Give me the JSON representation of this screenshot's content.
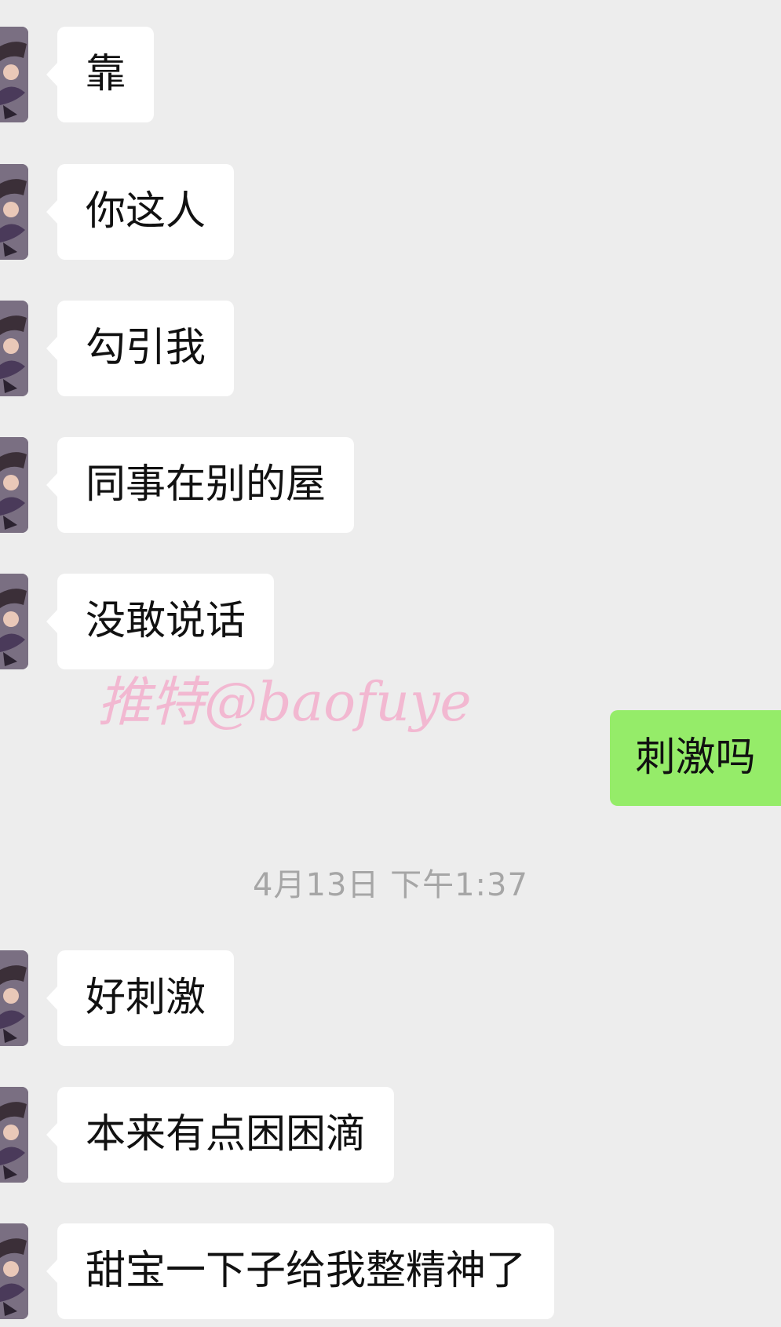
{
  "messages": [
    {
      "side": "in",
      "text": "靠"
    },
    {
      "side": "in",
      "text": "你这人"
    },
    {
      "side": "in",
      "text": "勾引我"
    },
    {
      "side": "in",
      "text": "同事在别的屋"
    },
    {
      "side": "in",
      "text": "没敢说话"
    },
    {
      "side": "out",
      "text": "刺激吗"
    },
    {
      "side": "in",
      "text": "好刺激"
    },
    {
      "side": "in",
      "text": "本来有点困困滴"
    },
    {
      "side": "in",
      "text": "甜宝一下子给我整精神了"
    }
  ],
  "timestamp": "4月13日 下午1:37",
  "watermark": "推特@baofuye",
  "colors": {
    "background": "#ededed",
    "incoming_bubble": "#ffffff",
    "outgoing_bubble": "#95ec69",
    "timestamp_text": "#a6a6a6",
    "watermark": "#f3b3cf"
  }
}
